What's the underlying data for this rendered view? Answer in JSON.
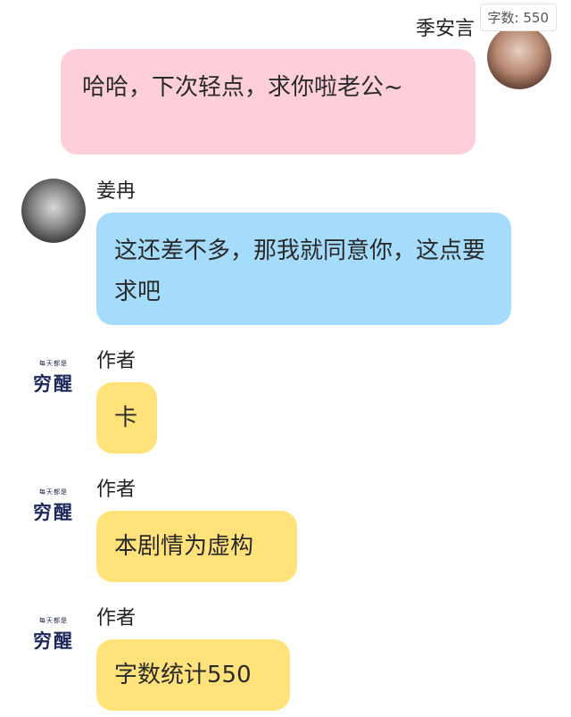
{
  "word_count_badge": "字数: 550",
  "author_logo": {
    "small_text": "每天都是",
    "big_text": "穷醒"
  },
  "messages": [
    {
      "sender": "季安言",
      "text": "哈哈，下次轻点，求你啦老公~"
    },
    {
      "sender": "姜冉",
      "text": "这还差不多，那我就同意你，这点要求吧"
    },
    {
      "sender": "作者",
      "text": "卡"
    },
    {
      "sender": "作者",
      "text": "本剧情为虚构"
    },
    {
      "sender": "作者",
      "text": "字数统计550"
    }
  ],
  "colors": {
    "self_bubble": "#fccfda",
    "other_bubble": "#a6dcfb",
    "author_bubble": "#ffe27a"
  }
}
